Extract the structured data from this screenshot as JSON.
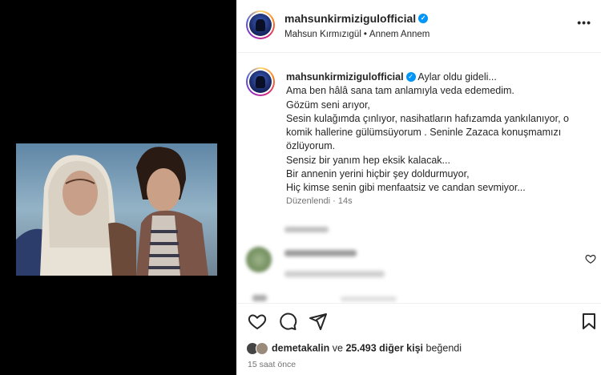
{
  "post": {
    "username": "mahsunkirmizigulofficial",
    "author_name": "Mahsun Kırmızıgül",
    "song": "Annem Annem",
    "separator": "•",
    "more_label": "•••",
    "verified_label": "✓"
  },
  "caption": {
    "username": "mahsunkirmizigulofficial",
    "lines": [
      "Aylar oldu gideli...",
      "Ama ben hâlâ sana tam anlamıyla veda edemedim.",
      "Gözüm seni arıyor,",
      "Sesin kulağımda çınlıyor, nasihatların hafızamda yankılanıyor, o",
      "komik hallerine gülümsüyorum . Seninle Zazaca konuşmamızı",
      "özlüyorum.",
      "Sensiz bir yanım hep eksik kalacak...",
      "Bir annenin yerini hiçbir şey doldurmuyor,",
      "Hiç kimse senin gibi menfaatsiz ve candan sevmiyor..."
    ],
    "edited": "Düzenlendi",
    "age": "14s"
  },
  "likes": {
    "user": "demetakalin",
    "connector": "ve",
    "count_text": "25.493 diğer kişi",
    "suffix": "beğendi"
  },
  "timestamp": "15 saat önce",
  "icons": {
    "like": "heart-icon",
    "comment": "comment-icon",
    "share": "share-icon",
    "save": "bookmark-icon"
  },
  "colors": {
    "verified": "#0095f6",
    "text": "#262626",
    "secondary": "#737373",
    "media_bg": "#000000"
  }
}
